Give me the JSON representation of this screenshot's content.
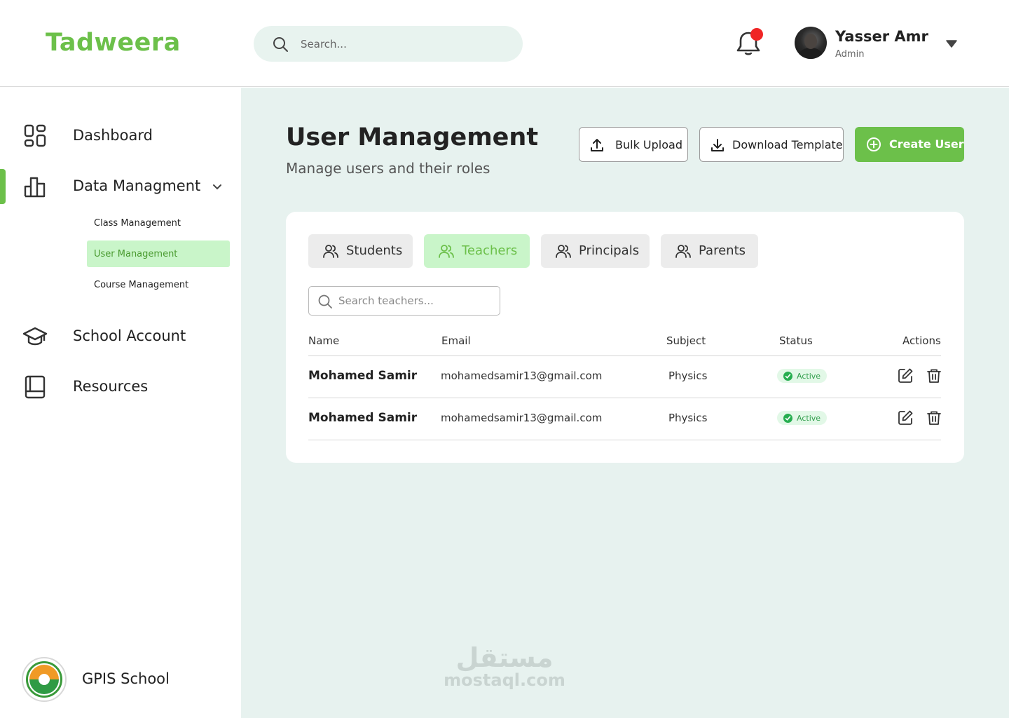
{
  "header": {
    "logo": "Tadweera",
    "search_placeholder": "Search...",
    "user": {
      "name": "Yasser Amr",
      "role": "Admin"
    }
  },
  "sidebar": {
    "items": [
      {
        "label": "Dashboard",
        "icon": "grid-icon"
      },
      {
        "label": "Data Managment",
        "icon": "bar-chart-icon"
      },
      {
        "label": "School Account",
        "icon": "graduation-cap-icon"
      },
      {
        "label": "Resources",
        "icon": "book-icon"
      }
    ],
    "sub_items": [
      {
        "label": "Class Management"
      },
      {
        "label": "User Management"
      },
      {
        "label": "Course Management"
      }
    ],
    "school_name": "GPIS School"
  },
  "main": {
    "title": "User Management",
    "subtitle": "Manage users and their roles",
    "buttons": {
      "bulk_upload": "Bulk Upload",
      "download_template": "Download Template",
      "create_user": "Create User"
    },
    "tabs": [
      {
        "label": "Students"
      },
      {
        "label": "Teachers"
      },
      {
        "label": "Principals"
      },
      {
        "label": "Parents"
      }
    ],
    "table_search_placeholder": "Search teachers...",
    "table": {
      "columns": [
        "Name",
        "Email",
        "Subject",
        "Status",
        "Actions"
      ],
      "rows": [
        {
          "name": "Mohamed Samir",
          "email": "mohamedsamir13@gmail.com",
          "subject": "Physics",
          "status": "Active"
        },
        {
          "name": "Mohamed Samir",
          "email": "mohamedsamir13@gmail.com",
          "subject": "Physics",
          "status": "Active"
        }
      ]
    }
  },
  "watermark": {
    "arabic": "مستقل",
    "latin": "mostaql.com"
  },
  "colors": {
    "accent": "#6cc04a",
    "main_bg": "#e7f2ef",
    "active_bg": "#c9f5c9",
    "notification": "#f02525"
  }
}
